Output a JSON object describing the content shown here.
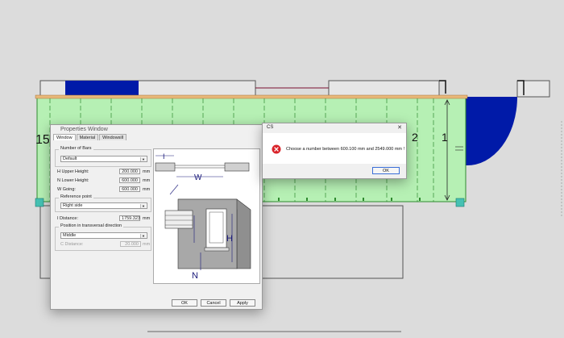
{
  "drawing": {
    "left_number": "15",
    "right_numbers": [
      "2",
      "1"
    ]
  },
  "properties_window": {
    "title": "Properties Window",
    "tabs": [
      "Window",
      "Material",
      "Windowsill"
    ],
    "number_of_bars": {
      "group_label": "Number of Bars",
      "value": "Default"
    },
    "fields": [
      {
        "label": "H Upper Height:",
        "value": "200.000",
        "unit": "mm"
      },
      {
        "label": "N Lower Height:",
        "value": "600.000",
        "unit": "mm"
      },
      {
        "label": "W Going:",
        "value": "600.000",
        "unit": "mm"
      }
    ],
    "reference_point": {
      "group_label": "Reference point",
      "value": "Right side"
    },
    "i_distance": {
      "label": "I Distance:",
      "value": "1759.323",
      "unit": "mm"
    },
    "transversal": {
      "group_label": "Position in transversal direction",
      "value": "Middle",
      "c_distance_label": "C Distance:",
      "c_distance_value": "20.000",
      "unit": "mm"
    },
    "diagram_labels": {
      "i": "I",
      "w": "W",
      "h": "H",
      "n": "N"
    },
    "buttons": {
      "ok": "OK",
      "cancel": "Cancel",
      "apply": "Apply"
    }
  },
  "message_box": {
    "title": "CS",
    "close": "✕",
    "message": "Choose a number between 600.100 mm and 2549.000 mm !",
    "ok": "OK"
  },
  "colors": {
    "background": "#dcdcdc",
    "wall_fill": "#b6f0b4",
    "wall_line": "#2f8a2f",
    "window_fill": "#001aa8",
    "header_bar": "#e8b87a",
    "error_red": "#d9232a",
    "teal_marker": "#46c1b3"
  }
}
